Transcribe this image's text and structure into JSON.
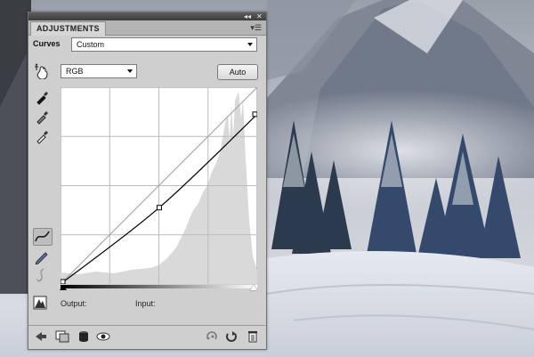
{
  "panel": {
    "tab_label": "ADJUSTMENTS",
    "titlebar_collapse_icon": "double-chevron-left",
    "titlebar_close_icon": "close-x",
    "menu_icon": "panel-menu"
  },
  "curves": {
    "adjustment_label": "Curves",
    "preset_value": "Custom",
    "channel_value": "RGB",
    "auto_label": "Auto",
    "output_label": "Output:",
    "input_label": "Input:",
    "output_value": "",
    "input_value": "",
    "curve_points": [
      [
        0,
        0
      ],
      [
        128,
        99
      ],
      [
        255,
        220
      ]
    ]
  },
  "tools": [
    "on-image-adjust-icon",
    "black-point-eyedropper-icon",
    "gray-point-eyedropper-icon",
    "white-point-eyedropper-icon",
    "curve-edit-points-icon",
    "pencil-draw-icon",
    "smooth-curve-icon"
  ],
  "bottom_icons": [
    "back-arrow-icon",
    "clip-to-layer-icon",
    "layer-mask-icon",
    "visibility-eye-icon",
    "previous-state-icon",
    "reset-icon",
    "delete-icon"
  ],
  "colors": {
    "panel_bg": "#cfcfcf",
    "titlebar": "#474747",
    "curve": "#000000"
  }
}
